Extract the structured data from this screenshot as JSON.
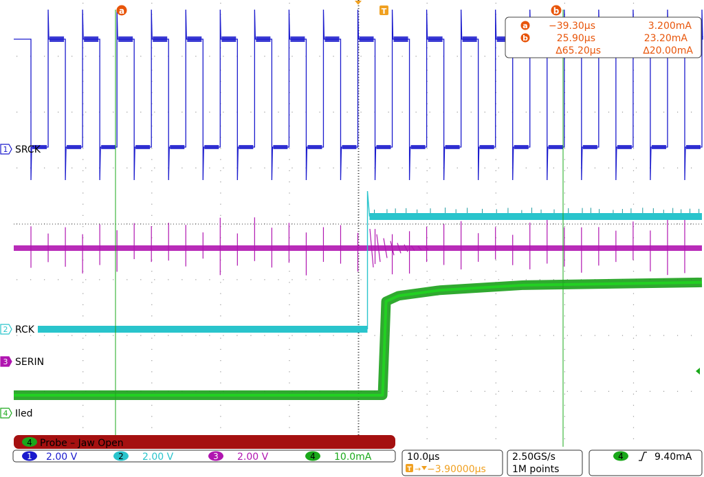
{
  "colors": {
    "ch1": "#1a1acd",
    "ch2": "#29c4cc",
    "ch3": "#b015b0",
    "ch4": "#1aa81a",
    "ch4_fill": "#19a019",
    "cursor": "#e8550a",
    "banner": "#a51010",
    "grid": "#9a9a9a"
  },
  "channel_labels": {
    "ch1": {
      "num": "1",
      "name": "SRCK"
    },
    "ch2": {
      "num": "2",
      "name": "RCK"
    },
    "ch3": {
      "num": "3",
      "name": "SERIN"
    },
    "ch4": {
      "num": "4",
      "name": "Iled"
    }
  },
  "cursor_readout": {
    "a_time": "−39.30µs",
    "a_value": "3.200mA",
    "b_time": "25.90µs",
    "b_value": "23.20mA",
    "delta_time": "∆65.20µs",
    "delta_value": "∆20.00mA"
  },
  "markers": {
    "a": "a",
    "b": "b",
    "trigger": "T"
  },
  "banner": {
    "num": "4",
    "text": "Probe – Jaw Open"
  },
  "status": {
    "ch1_scale": "2.00 V",
    "ch2_scale": "2.00 V",
    "ch3_scale": "2.00 V",
    "ch4_scale": "10.0mA",
    "timebase": "10.0µs",
    "trigger_position": "−3.90000µs",
    "sample_rate": "2.50GS/s",
    "record_length": "1M points",
    "trigger_channel": "4",
    "trigger_slope": "rising",
    "trigger_level": "9.40mA"
  },
  "chart_data": {
    "type": "line",
    "title": "",
    "xlabel": "",
    "ylabel": "",
    "divisions": {
      "x": 10,
      "y": 8
    },
    "grid": true,
    "x_units": "µs",
    "xlim": [
      -53.9,
      46.1
    ],
    "series": [
      {
        "name": "SRCK",
        "channel": 1,
        "scale": "2.00 V",
        "kind": "square clock",
        "levels_V": [
          0,
          5
        ],
        "period_us": 5.0
      },
      {
        "name": "RCK",
        "channel": 2,
        "scale": "2.00 V",
        "kind": "step",
        "x": [
          -53.9,
          -2.5,
          -2.5,
          46.1
        ],
        "y_V": [
          0.0,
          0.0,
          5.0,
          5.0
        ]
      },
      {
        "name": "SERIN",
        "channel": 3,
        "scale": "2.00 V",
        "kind": "constant with switching spikes",
        "level_V": 0.0
      },
      {
        "name": "Iled",
        "channel": 4,
        "scale": "10.0mA",
        "kind": "step",
        "x": [
          -53.9,
          -0.3,
          0.2,
          2.0,
          8.0,
          20.0,
          46.1
        ],
        "y_mA": [
          3.2,
          3.2,
          20.0,
          21.0,
          22.0,
          22.9,
          23.4
        ]
      }
    ]
  }
}
